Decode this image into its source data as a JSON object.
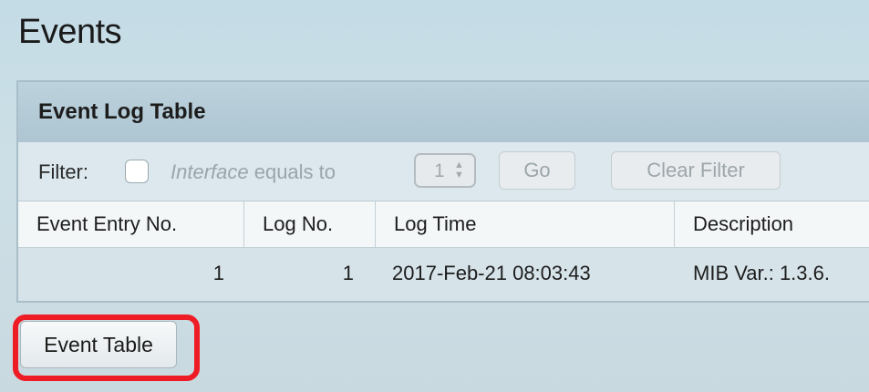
{
  "page": {
    "title": "Events"
  },
  "panel": {
    "title": "Event Log Table"
  },
  "filter": {
    "label": "Filter:",
    "condition_field": "Interface",
    "condition_text": " equals to",
    "stepper_value": "1",
    "go_label": "Go",
    "clear_label": "Clear Filter"
  },
  "table": {
    "columns": [
      "Event Entry No.",
      "Log No.",
      "Log Time",
      "Description"
    ],
    "rows": [
      {
        "event_entry_no": "1",
        "log_no": "1",
        "log_time": "2017-Feb-21 08:03:43",
        "description": "MIB Var.: 1.3.6."
      }
    ]
  },
  "actions": {
    "event_table_label": "Event Table"
  },
  "colors": {
    "highlight": "#ee1c24",
    "panel_header": "#aec6d2",
    "background": "#c4dce6"
  }
}
